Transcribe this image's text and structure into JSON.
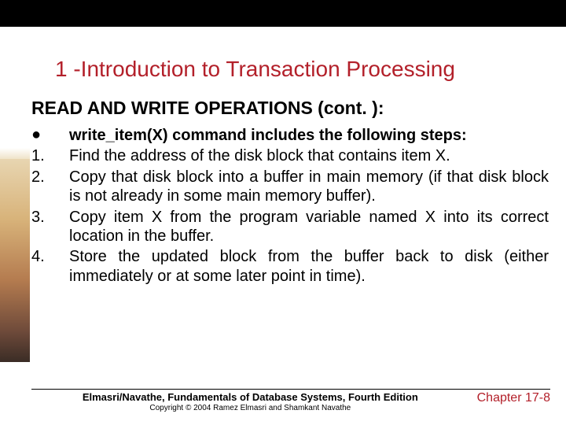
{
  "title": "1 -Introduction to Transaction Processing",
  "subtitle": "READ AND WRITE OPERATIONS (cont. ):",
  "bullet": {
    "lead": "write_item(X) command includes the following steps:"
  },
  "steps": [
    {
      "n": "1.",
      "t": "Find the address of the disk block that contains item X."
    },
    {
      "n": "2.",
      "t": "Copy that disk block into a buffer in main memory (if that disk block is not already in some main memory buffer)."
    },
    {
      "n": "3.",
      "t": "Copy item X from the program variable named X into its correct location in the buffer."
    },
    {
      "n": "4.",
      "t": "Store the updated block from the buffer back to disk (either immediately or at some later point in time)."
    }
  ],
  "footer": {
    "book": "Elmasri/Navathe, Fundamentals of Database Systems, Fourth Edition",
    "copyright": "Copyright © 2004 Ramez Elmasri and Shamkant Navathe",
    "chapter": "Chapter 17-8"
  }
}
